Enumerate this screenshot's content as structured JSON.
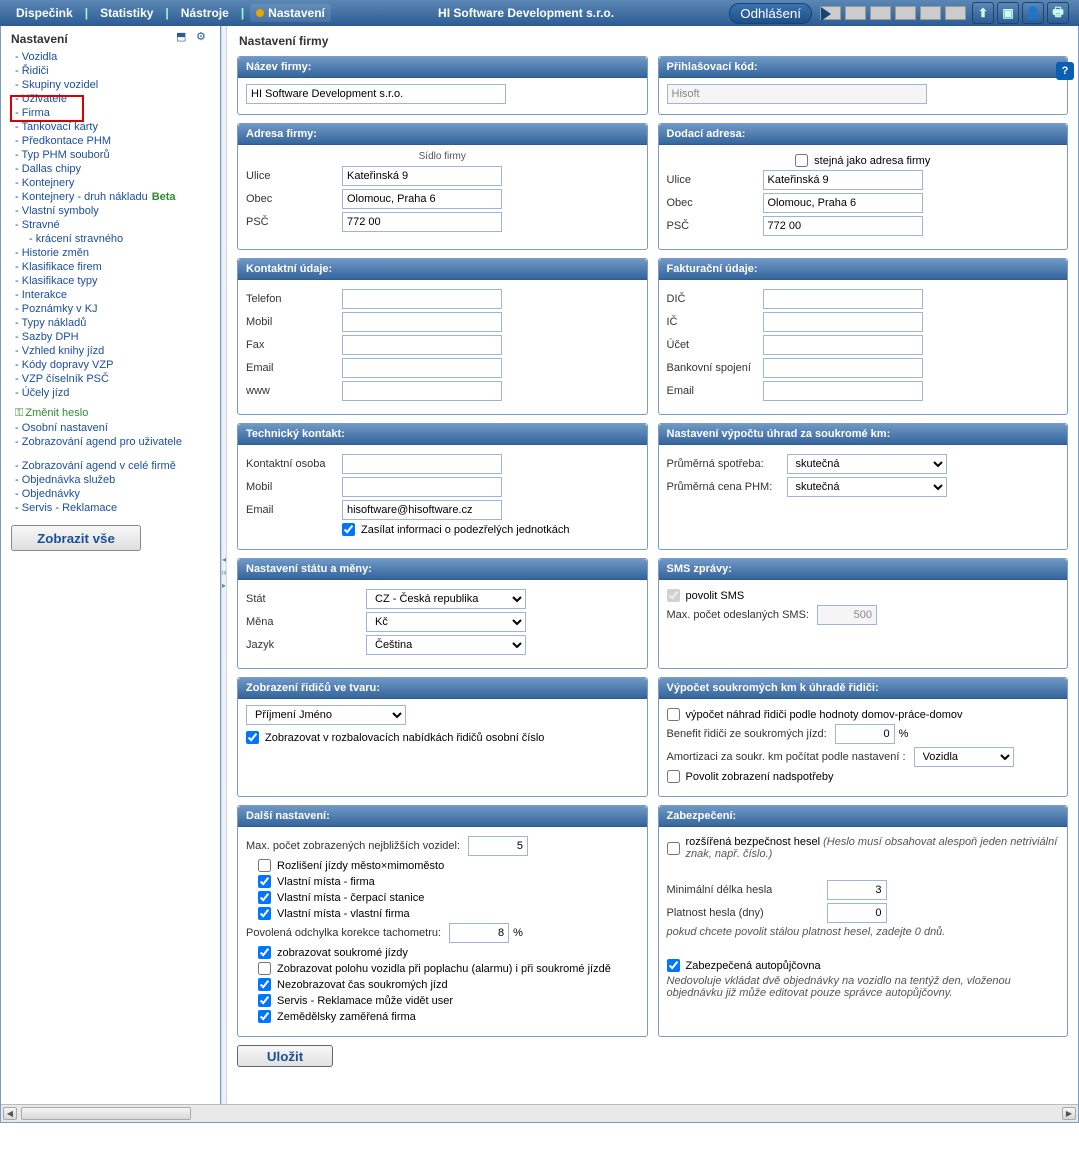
{
  "topbar": {
    "menu": [
      "Dispečink",
      "Statistiky",
      "Nástroje",
      "Nastavení"
    ],
    "activeIndex": 3,
    "company": "HI Software Development s.r.o.",
    "logout": "Odhlášení"
  },
  "sidebar": {
    "title": "Nastavení",
    "items": [
      {
        "label": "Vozidla"
      },
      {
        "label": "Řidiči"
      },
      {
        "label": "Skupiny vozidel"
      },
      {
        "label": "Uživatele"
      },
      {
        "label": "Firma"
      },
      {
        "label": "Tankovací karty"
      },
      {
        "label": "Předkontace PHM"
      },
      {
        "label": "Typ PHM souborů"
      },
      {
        "label": "Dallas chipy"
      },
      {
        "label": "Kontejnery"
      },
      {
        "label": "Kontejnery - druh nákladu",
        "beta": true
      },
      {
        "label": "Vlastní symboly"
      },
      {
        "label": "Stravné"
      },
      {
        "label": "krácení stravného",
        "indent": true
      },
      {
        "label": "Historie změn"
      },
      {
        "label": "Klasifikace firem"
      },
      {
        "label": "Klasifikace typy"
      },
      {
        "label": "Interakce"
      },
      {
        "label": "Poznámky v KJ"
      },
      {
        "label": "Typy nákladů"
      },
      {
        "label": "Sazby DPH"
      },
      {
        "label": "Vzhled knihy jízd"
      },
      {
        "label": "Kódy dopravy VZP"
      },
      {
        "label": "VZP číselník PSČ"
      },
      {
        "label": "Účely jízd"
      }
    ],
    "changepw": "Změnit heslo",
    "personal": "Osobní nastavení",
    "agendUser": "Zobrazování agend pro uživatele",
    "agendFirm": "Zobrazování agend v celé firmě",
    "orderServices": "Objednávka služeb",
    "orders": "Objednávky",
    "service": "Servis - Reklamace",
    "showAll": "Zobrazit vše"
  },
  "main": {
    "title": "Nastavení firmy",
    "panels": {
      "name": {
        "hd": "Název firmy:",
        "value": "HI Software Development s.r.o."
      },
      "login": {
        "hd": "Přihlašovací kód:",
        "value": "Hisoft"
      },
      "address": {
        "hd": "Adresa firmy:",
        "subhdr": "Sídlo firmy",
        "rows": [
          {
            "label": "Ulice",
            "value": "Kateřinská 9"
          },
          {
            "label": "Obec",
            "value": "Olomouc, Praha 6"
          },
          {
            "label": "PSČ",
            "value": "772 00"
          }
        ]
      },
      "delivery": {
        "hd": "Dodací adresa:",
        "same": "stejná jako adresa firmy",
        "rows": [
          {
            "label": "Ulice",
            "value": "Kateřinská 9"
          },
          {
            "label": "Obec",
            "value": "Olomouc, Praha 6"
          },
          {
            "label": "PSČ",
            "value": "772 00"
          }
        ]
      },
      "contact": {
        "hd": "Kontaktní údaje:",
        "rows": [
          {
            "label": "Telefon",
            "value": ""
          },
          {
            "label": "Mobil",
            "value": ""
          },
          {
            "label": "Fax",
            "value": ""
          },
          {
            "label": "Email",
            "value": ""
          },
          {
            "label": "www",
            "value": ""
          }
        ]
      },
      "billing": {
        "hd": "Fakturační údaje:",
        "rows": [
          {
            "label": "DIČ",
            "value": ""
          },
          {
            "label": "IČ",
            "value": ""
          },
          {
            "label": "Účet",
            "value": ""
          },
          {
            "label": "Bankovní spojení",
            "value": ""
          },
          {
            "label": "Email",
            "value": ""
          }
        ]
      },
      "tech": {
        "hd": "Technický kontakt:",
        "rows": [
          {
            "label": "Kontaktní osoba",
            "value": ""
          },
          {
            "label": "Mobil",
            "value": ""
          },
          {
            "label": "Email",
            "value": "hisoftware@hisoftware.cz"
          }
        ],
        "checkbox": "Zasílat informaci o podezřelých jednotkách"
      },
      "privateKm": {
        "hd": "Nastavení výpočtu úhrad za soukromé km:",
        "rows": [
          {
            "label": "Průměrná spotřeba:",
            "value": "skutečná"
          },
          {
            "label": "Průměrná cena PHM:",
            "value": "skutečná"
          }
        ]
      },
      "state": {
        "hd": "Nastavení státu a měny:",
        "rows": [
          {
            "label": "Stát",
            "value": "CZ - Česká republika"
          },
          {
            "label": "Měna",
            "value": "Kč"
          },
          {
            "label": "Jazyk",
            "value": "Čeština"
          }
        ]
      },
      "sms": {
        "hd": "SMS zprávy:",
        "allow": "povolit SMS",
        "maxLabel": "Max. počet odeslaných SMS:",
        "maxValue": "500"
      },
      "drivers": {
        "hd": "Zobrazení řidičů ve tvaru:",
        "format": "Příjmení Jméno",
        "checkbox": "Zobrazovat v rozbalovacích nabídkách řidičů osobní číslo"
      },
      "privCalc": {
        "hd": "Výpočet soukromých km k úhradě řidiči:",
        "cb1": "výpočet náhrad řidiči podle hodnoty domov-práce-domov",
        "benefitLabel": "Benefit řidiči ze soukromých jízd:",
        "benefitValue": "0",
        "benefitUnit": "%",
        "amortLabel": "Amortizaci za soukr. km počítat podle nastavení :",
        "amortValue": "Vozidla",
        "cb2": "Povolit zobrazení nadspotřeby"
      },
      "other": {
        "hd": "Další nastavení:",
        "maxVehLabel": "Max. počet zobrazených nejbližších vozidel:",
        "maxVehValue": "5",
        "cb": [
          {
            "label": "Rozlišení jízdy město×mimoměsto",
            "checked": false
          },
          {
            "label": "Vlastní místa - firma",
            "checked": true
          },
          {
            "label": "Vlastní místa - čerpací stanice",
            "checked": true
          },
          {
            "label": "Vlastní místa - vlastní firma",
            "checked": true
          }
        ],
        "devLabel": "Povolená odchylka korekce tachometru:",
        "devValue": "8",
        "devUnit": "%",
        "cb2": [
          {
            "label": "zobrazovat soukromé jízdy",
            "checked": true
          },
          {
            "label": "Zobrazovat polohu vozidla při poplachu (alarmu) i při soukromé jízdě",
            "checked": false
          },
          {
            "label": "Nezobrazovat čas soukromých jízd",
            "checked": true
          },
          {
            "label": "Servis - Reklamace může vidět user",
            "checked": true
          },
          {
            "label": "Zemědělsky zaměřená firma",
            "checked": true
          }
        ]
      },
      "security": {
        "hd": "Zabezpečení:",
        "cb1": "rozšířená bezpečnost hesel",
        "cb1note": "(Heslo musí obsahovat alespoň jeden netriviální znak, např. číslo.)",
        "minLenLabel": "Minimální délka hesla",
        "minLenValue": "3",
        "validLabel": "Platnost hesla (dny)",
        "validValue": "0",
        "validNote": "pokud chcete povolit stálou platnost hesel, zadejte 0 dnů.",
        "cb2": "Zabezpečená autopůjčovna",
        "cb2note": "Nedovoluje vkládat dvě objednávky na vozidlo na tentýž den, vloženou objednávku již může editovat pouze správce autopůjčovny."
      }
    },
    "save": "Uložit"
  }
}
